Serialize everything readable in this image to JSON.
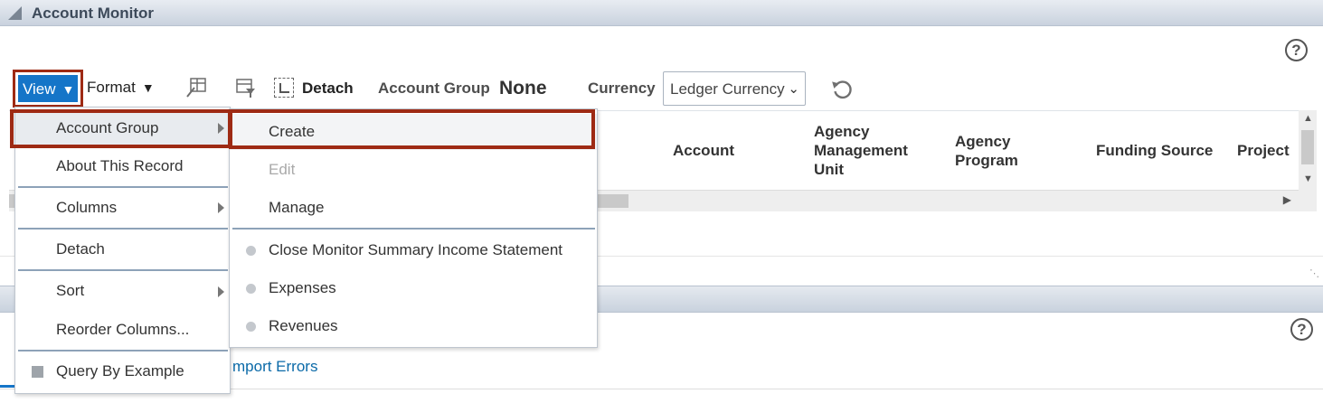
{
  "panel": {
    "title": "Account Monitor"
  },
  "toolbar": {
    "view_label": "View",
    "format_label": "Format",
    "detach_label": "Detach",
    "account_group_label": "Account Group",
    "account_group_value": "None",
    "currency_label": "Currency",
    "currency_value": "Ledger Currency"
  },
  "table": {
    "columns": [
      "Account",
      "Agency Management Unit",
      "Agency Program",
      "Funding Source",
      "Project"
    ]
  },
  "view_menu": {
    "items": [
      "Account Group",
      "About This Record",
      "Columns",
      "Detach",
      "Sort",
      "Reorder Columns...",
      "Query By Example"
    ]
  },
  "account_group_submenu": {
    "items": [
      "Create",
      "Edit",
      "Manage"
    ],
    "groups": [
      "Close Monitor Summary Income Statement",
      "Expenses",
      "Revenues"
    ]
  },
  "lower_panel": {
    "tab_label": "mport Errors"
  },
  "colors": {
    "accent": "#1575c8",
    "highlight": "#9e2a14",
    "link": "#0b6aa8"
  }
}
